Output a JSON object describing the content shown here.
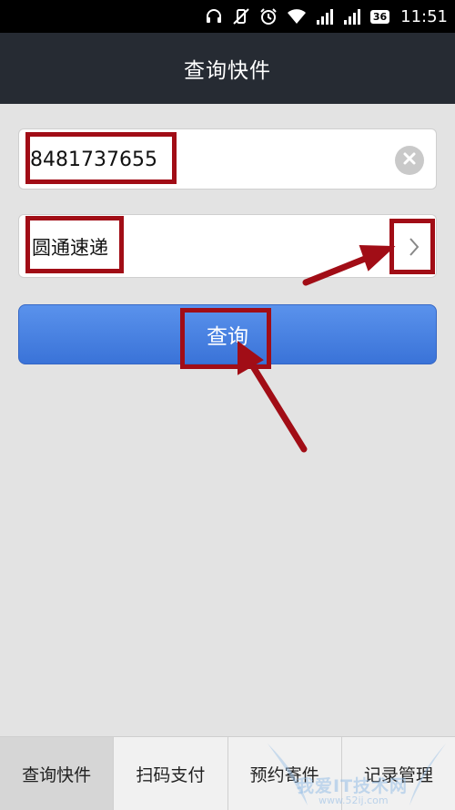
{
  "status_bar": {
    "network_badge": "36",
    "time": "11:51",
    "icons": [
      "headphones-icon",
      "vibrate-off-icon",
      "alarm-icon",
      "wifi-icon",
      "signal-icon",
      "signal-icon"
    ]
  },
  "header": {
    "title": "查询快件"
  },
  "form": {
    "tracking_number": "8481737655",
    "courier": "圆通速递",
    "query_button": "查询"
  },
  "tabs": [
    {
      "label": "查询快件",
      "active": true
    },
    {
      "label": "扫码支付",
      "active": false
    },
    {
      "label": "预约寄件",
      "active": false
    },
    {
      "label": "记录管理",
      "active": false
    }
  ],
  "watermark": {
    "text": "我爱IT技术网",
    "url": "www.52ij.com"
  },
  "colors": {
    "header_bg": "#262b33",
    "button_blue": "#3f7bdc",
    "highlight_red": "#a10d16",
    "page_bg": "#e3e3e3"
  }
}
